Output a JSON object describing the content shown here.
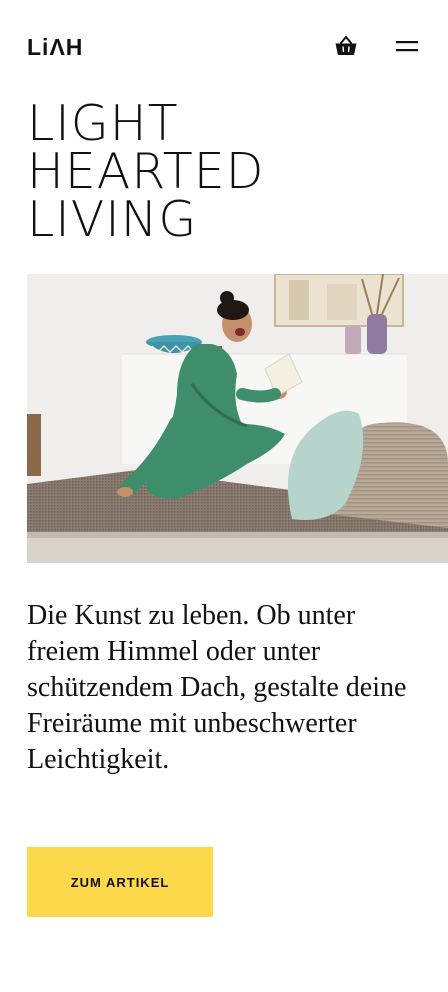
{
  "header": {
    "logo_text": "LiΛH",
    "cart_icon": "basket-icon",
    "menu_icon": "hamburger-menu-icon"
  },
  "hero": {
    "title_lines": [
      "LIGHT",
      "HEARTED",
      "LIVING"
    ]
  },
  "image": {
    "subject": "woman-reading-on-daybed"
  },
  "body": {
    "text": "Die Kunst zu leben. Ob unter freiem Himmel oder unter schützendem Dach, gestalte deine Freiräume mit unbeschwerter Leichtigkeit."
  },
  "cta": {
    "label": "ZUM ARTIKEL",
    "color": "#fcd94a"
  }
}
